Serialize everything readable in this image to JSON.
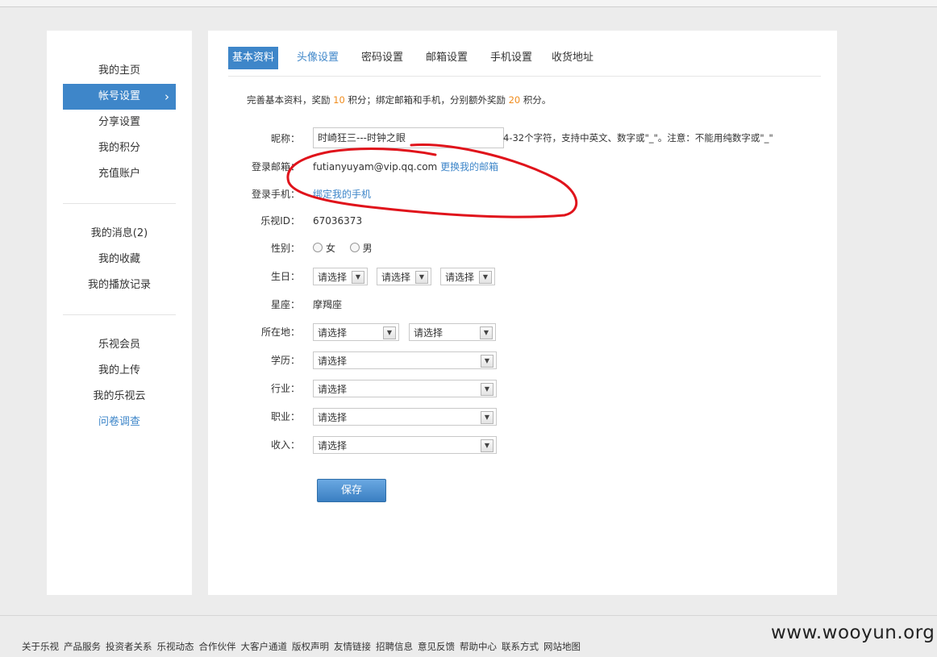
{
  "sidebar": {
    "group1": [
      "我的主页",
      "帐号设置",
      "分享设置",
      "我的积分",
      "充值账户"
    ],
    "group2": [
      "我的消息(2)",
      "我的收藏",
      "我的播放记录"
    ],
    "group3": [
      "乐视会员",
      "我的上传",
      "我的乐视云",
      "问卷调查"
    ],
    "active_chevron": "›"
  },
  "tabs": [
    "基本资料",
    "头像设置",
    "密码设置",
    "邮箱设置",
    "手机设置",
    "收货地址"
  ],
  "notice": {
    "part1": "完善基本资料，奖励 ",
    "points1": "10",
    "part2": " 积分；绑定邮箱和手机，分别额外奖励 ",
    "points2": "20",
    "part3": " 积分。"
  },
  "form": {
    "nickname_label": "昵称：",
    "nickname_value": "时崎狂三---时钟之眼",
    "nickname_hint": "4-32个字符，支持中英文、数字或\"_\"。注意：不能用纯数字或\"_\"",
    "email_label": "登录邮箱：",
    "email_value": "futianyuyam@vip.qq.com",
    "email_change_link": "更换我的邮箱",
    "phone_label": "登录手机：",
    "phone_bind_link": "绑定我的手机",
    "id_label": "乐视ID：",
    "id_value": "67036373",
    "gender_label": "性别：",
    "gender_female": "女",
    "gender_male": "男",
    "birthday_label": "生日：",
    "constellation_label": "星座：",
    "constellation_value": "摩羯座",
    "location_label": "所在地：",
    "education_label": "学历：",
    "industry_label": "行业：",
    "occupation_label": "职业：",
    "income_label": "收入：",
    "select_placeholder": "请选择",
    "save_label": "保存"
  },
  "footer": {
    "links": [
      "关于乐视",
      "产品服务",
      "投资者关系",
      "乐视动态",
      "合作伙伴",
      "大客户通道",
      "版权声明",
      "友情链接",
      "招聘信息",
      "意见反馈",
      "帮助中心",
      "联系方式",
      "网站地图"
    ],
    "watermark": "www.wooyun.org"
  },
  "colors": {
    "accent": "#3e86c9",
    "points": "#f08c1d",
    "annotation": "#e0131b"
  }
}
